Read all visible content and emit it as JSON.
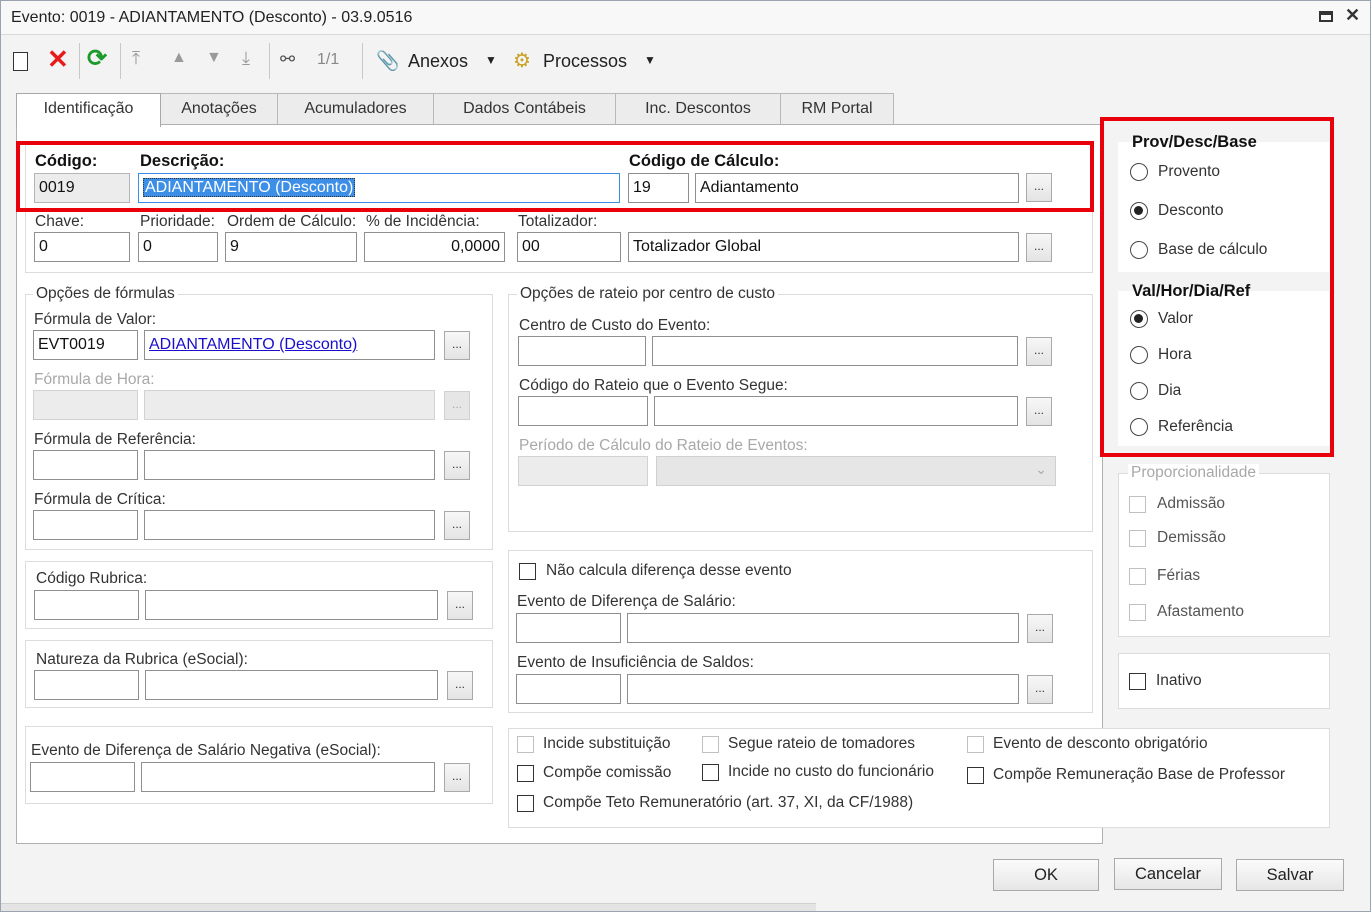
{
  "window": {
    "title": "Evento: 0019 - ADIANTAMENTO (Desconto) - 03.9.0516"
  },
  "toolbar": {
    "record_counter": "1/1",
    "anexos": "Anexos",
    "processos": "Processos"
  },
  "tabs": [
    "Identificação",
    "Anotações",
    "Acumuladores",
    "Dados Contábeis",
    "Inc. Descontos",
    "RM Portal"
  ],
  "ident": {
    "codigo_label": "Código:",
    "codigo": "0019",
    "descricao_label": "Descrição:",
    "descricao": "ADIANTAMENTO (Desconto)",
    "codcalc_label": "Código de Cálculo:",
    "codcalc": "19",
    "codcalc_desc": "Adiantamento",
    "chave_label": "Chave:",
    "chave": "0",
    "prioridade_label": "Prioridade:",
    "prioridade": "0",
    "ordem_label": "Ordem de Cálculo:",
    "ordem": "9",
    "incidencia_label": "% de Incidência:",
    "incidencia": "0,0000",
    "totalizador_label": "Totalizador:",
    "totalizador": "00",
    "totalizador_desc": "Totalizador Global"
  },
  "formulas": {
    "title": "Opções de fórmulas",
    "valor_label": "Fórmula de Valor:",
    "valor_code": "EVT0019",
    "valor_desc": "ADIANTAMENTO (Desconto)",
    "hora_label": "Fórmula de Hora:",
    "ref_label": "Fórmula de Referência:",
    "critica_label": "Fórmula de Crítica:"
  },
  "rateio": {
    "title": "Opções de rateio por centro de custo",
    "centro_label": "Centro de Custo do Evento:",
    "codigo_label": "Código do Rateio que o Evento Segue:",
    "periodo_label": "Período de Cálculo do Rateio de Eventos:"
  },
  "rubrica": {
    "codigo_label": "Código Rubrica:",
    "natureza_label": "Natureza da Rubrica (eSocial):",
    "negativa_label": "Evento de Diferença de Salário Negativa (eSocial):"
  },
  "diferenca": {
    "nao_calcula": "Não calcula diferença desse evento",
    "dif_salario_label": "Evento de Diferença de Salário:",
    "insuficiencia_label": "Evento de Insuficiência de Saldos:"
  },
  "checks": {
    "incide_subst": "Incide substituição",
    "segue_rateio": "Segue rateio de tomadores",
    "desconto_obrig": "Evento de desconto obrigatório",
    "compoe_comissao": "Compõe comissão",
    "incide_custo": "Incide no custo do funcionário",
    "compoe_rem_prof": "Compõe Remuneração Base de Professor",
    "compoe_teto": "Compõe Teto Remuneratório (art. 37, XI, da CF/1988)"
  },
  "prov": {
    "title": "Prov/Desc/Base",
    "options": [
      "Provento",
      "Desconto",
      "Base de cálculo"
    ],
    "selected": "Desconto"
  },
  "val": {
    "title": "Val/Hor/Dia/Ref",
    "options": [
      "Valor",
      "Hora",
      "Dia",
      "Referência"
    ],
    "selected": "Valor"
  },
  "proporc": {
    "title": "Proporcionalidade",
    "options": [
      "Admissão",
      "Demissão",
      "Férias",
      "Afastamento"
    ]
  },
  "inativo": "Inativo",
  "buttons": {
    "ok": "OK",
    "cancelar": "Cancelar",
    "salvar": "Salvar"
  },
  "colors": {
    "highlight": "#e8000b",
    "selection": "#3d8ee6",
    "link": "#1a0dcc"
  }
}
